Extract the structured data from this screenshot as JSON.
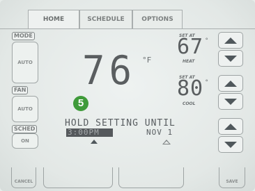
{
  "tabs": [
    "HOME",
    "SCHEDULE",
    "OPTIONS"
  ],
  "left": {
    "mode_label": "MODE",
    "mode_value": "AUTO",
    "fan_label": "FAN",
    "fan_value": "AUTO",
    "sched_label": "SCHED",
    "sched_value": "ON"
  },
  "temperature": {
    "current": "76",
    "unit": "°F"
  },
  "heat": {
    "set_at": "SET AT",
    "value": "67",
    "unit": "°",
    "mode": "HEAT"
  },
  "cool": {
    "set_at": "SET AT",
    "value": "80",
    "unit": "°",
    "mode": "COOL"
  },
  "step_badge": "5",
  "hold": {
    "line": "HOLD SETTING UNTIL",
    "time": "3:00PM",
    "date": "NOV  1"
  },
  "bottom": {
    "cancel": "CANCEL",
    "save": "SAVE"
  },
  "colors": {
    "badge": "#3f9b3a",
    "lcd_text": "#5a5e60",
    "screen": "#e7ecea"
  }
}
